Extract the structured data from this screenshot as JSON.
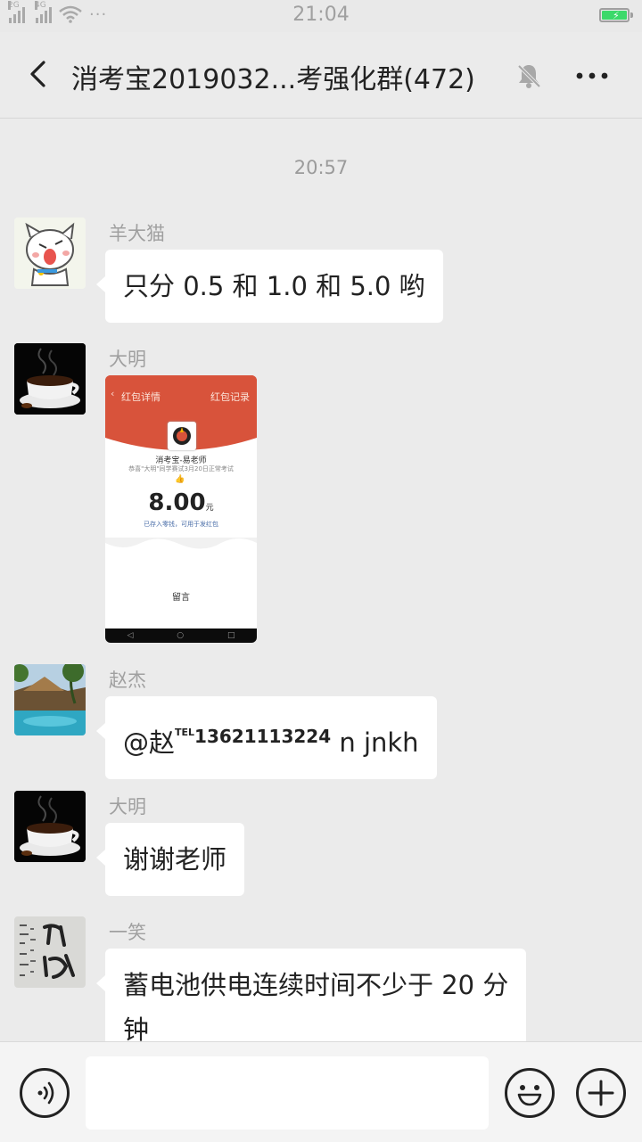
{
  "status_bar": {
    "net1": "2G",
    "net2": "4G",
    "more": "···",
    "time": "21:04",
    "battery_charging": true,
    "battery_color": "#3cd96a"
  },
  "chat": {
    "title": "消考宝2019032...考强化群(472)",
    "back_icon": "back-arrow-icon",
    "mute_icon": "bell-off-icon",
    "more_icon": "more-icon"
  },
  "timestamp": "20:57",
  "messages": [
    {
      "sender": "羊大猫",
      "text": "只分 0.5 和 1.0 和 5.0 哟",
      "avatar": "cartoon-cat"
    },
    {
      "sender": "大明",
      "type": "image",
      "avatar": "coffee-cup",
      "image": {
        "header_left": "红包详情",
        "header_right": "红包记录",
        "from": "消考宝-易老师",
        "greeting": "恭喜\"大明\"同学赛试3月20日正常考试",
        "amount": "8.00",
        "unit": "元",
        "note": "已存入零钱，可用于发红包",
        "reply": "留言"
      }
    },
    {
      "sender": "赵杰",
      "prefix": "@赵",
      "tel": "TEL",
      "phone": "13621113224",
      "suffix": " n jnkh",
      "avatar": "resort-pool"
    },
    {
      "sender": "大明",
      "text": "谢谢老师",
      "avatar": "coffee-cup"
    },
    {
      "sender": "一笑",
      "line1": "蓄电池供电连续时间不少于 20 分",
      "line2": "钟",
      "avatar": "calligraphy"
    }
  ],
  "input": {
    "voice_icon": "voice-icon",
    "emoji_icon": "emoji-icon",
    "plus_icon": "plus-icon",
    "placeholder": ""
  }
}
